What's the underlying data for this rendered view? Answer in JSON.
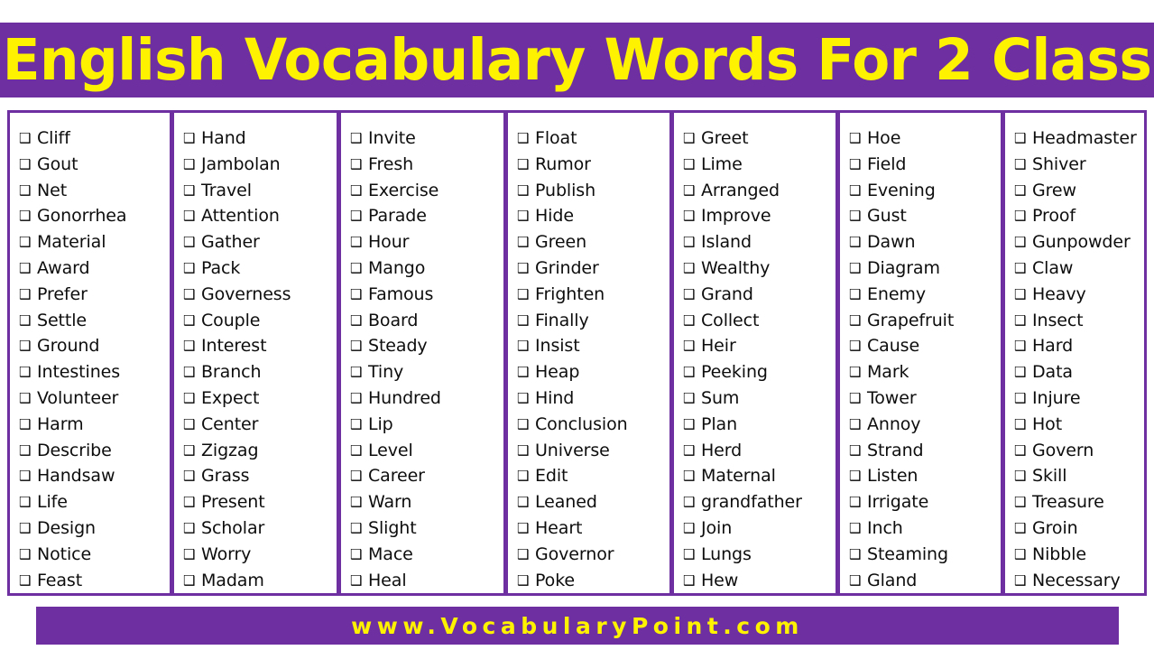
{
  "header": {
    "title": "English Vocabulary Words For 2 Class",
    "background_color": "#6E30A0",
    "text_color": "#FFF200"
  },
  "footer": {
    "url": "www.VocabularyPoint.com",
    "background_color": "#6E30A0",
    "text_color": "#FFF200"
  },
  "list": {
    "bullet_icon": "checkbox-square-icon",
    "bullet_glyph": "❑",
    "border_color": "#6E30A0",
    "divider_color": "#6E30A0",
    "columns": [
      {
        "index": 1,
        "words": [
          "Cliff",
          "Gout",
          "Net",
          "Gonorrhea",
          "Material",
          "Award",
          "Prefer",
          "Settle",
          "Ground",
          "Intestines",
          "Volunteer",
          "Harm",
          "Describe",
          "Handsaw",
          "Life",
          "Design",
          "Notice",
          "Feast"
        ]
      },
      {
        "index": 2,
        "words": [
          "Hand",
          "Jambolan",
          "Travel",
          "Attention",
          "Gather",
          "Pack",
          "Governess",
          "Couple",
          "Interest",
          "Branch",
          "Expect",
          "Center",
          "Zigzag",
          "Grass",
          "Present",
          "Scholar",
          "Worry",
          "Madam"
        ]
      },
      {
        "index": 3,
        "words": [
          "Invite",
          "Fresh",
          "Exercise",
          "Parade",
          "Hour",
          "Mango",
          "Famous",
          "Board",
          "Steady",
          "Tiny",
          "Hundred",
          "Lip",
          "Level",
          "Career",
          "Warn",
          "Slight",
          "Mace",
          "Heal"
        ]
      },
      {
        "index": 4,
        "words": [
          "Float",
          "Rumor",
          "Publish",
          "Hide",
          "Green",
          "Grinder",
          "Frighten",
          "Finally",
          "Insist",
          "Heap",
          "Hind",
          "Conclusion",
          "Universe",
          "Edit",
          "Leaned",
          "Heart",
          "Governor",
          "Poke"
        ]
      },
      {
        "index": 5,
        "words": [
          "Greet",
          "Lime",
          "Arranged",
          "Improve",
          "Island",
          "Wealthy",
          "Grand",
          "Collect",
          "Heir",
          "Peeking",
          "Sum",
          "Plan",
          "Herd",
          "Maternal",
          "grandfather",
          "Join",
          "Lungs",
          "Hew"
        ]
      },
      {
        "index": 6,
        "words": [
          "Hoe",
          "Field",
          "Evening",
          "Gust",
          "Dawn",
          "Diagram",
          "Enemy",
          "Grapefruit",
          "Cause",
          "Mark",
          "Tower",
          "Annoy",
          "Strand",
          "Listen",
          "Irrigate",
          "Inch",
          "Steaming",
          "Gland"
        ]
      },
      {
        "index": 7,
        "words": [
          "Headmaster",
          "Shiver",
          "Grew",
          "Proof",
          "Gunpowder",
          "Claw",
          "Heavy",
          "Insect",
          "Hard",
          "Data",
          "Injure",
          "Hot",
          "Govern",
          "Skill",
          "Treasure",
          "Groin",
          "Nibble",
          "Necessary"
        ]
      }
    ]
  }
}
